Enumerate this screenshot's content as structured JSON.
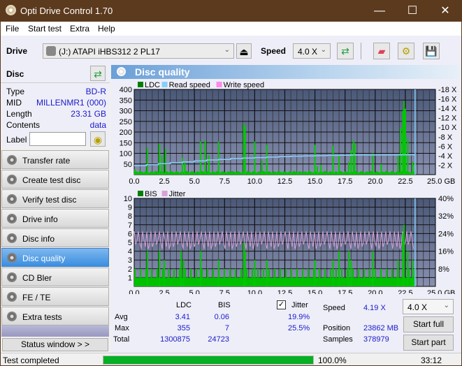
{
  "window": {
    "title": "Opti Drive Control 1.70",
    "controls": [
      "minimize",
      "maximize",
      "close"
    ]
  },
  "menu": [
    "File",
    "Start test",
    "Extra",
    "Help"
  ],
  "toolbar": {
    "drive_label": "Drive",
    "drive_value": "(J:)  ATAPI iHBS312  2 PL17",
    "speed_label": "Speed",
    "speed_value": "4.0 X",
    "icons": [
      "eject-icon",
      "refresh-icon",
      "erase-icon",
      "settings-icon",
      "save-icon"
    ]
  },
  "disc": {
    "header": "Disc",
    "rows": [
      {
        "key": "Type",
        "value": "BD-R"
      },
      {
        "key": "MID",
        "value": "MILLENMR1 (000)"
      },
      {
        "key": "Length",
        "value": "23.31 GB"
      },
      {
        "key": "Contents",
        "value": "data"
      }
    ],
    "label_key": "Label",
    "label_value": ""
  },
  "nav": [
    {
      "label": "Transfer rate",
      "active": false
    },
    {
      "label": "Create test disc",
      "active": false
    },
    {
      "label": "Verify test disc",
      "active": false
    },
    {
      "label": "Drive info",
      "active": false
    },
    {
      "label": "Disc info",
      "active": false
    },
    {
      "label": "Disc quality",
      "active": true
    },
    {
      "label": "CD Bler",
      "active": false
    },
    {
      "label": "FE / TE",
      "active": false
    },
    {
      "label": "Extra tests",
      "active": false
    }
  ],
  "status_window_label": "Status window > >",
  "panel_title": "Disc quality",
  "chart_data": [
    {
      "type": "bar",
      "title": "LDC / Read speed",
      "legend": [
        {
          "name": "LDC",
          "color": "#008000"
        },
        {
          "name": "Read speed",
          "color": "#87cefa"
        },
        {
          "name": "Write speed",
          "color": "#ff88ee"
        }
      ],
      "xlabel": "GB",
      "xlim": [
        0,
        25
      ],
      "x_ticks": [
        "0.0",
        "2.5",
        "5.0",
        "7.5",
        "10.0",
        "12.5",
        "15.0",
        "17.5",
        "20.0",
        "22.5",
        "25.0 GB"
      ],
      "ylim": [
        0,
        400
      ],
      "y_ticks": [
        "400",
        "350",
        "300",
        "250",
        "200",
        "150",
        "100",
        "50"
      ],
      "y2lim": [
        0,
        18
      ],
      "y2_ticks": [
        "18 X",
        "16 X",
        "14 X",
        "12 X",
        "10 X",
        "8 X",
        "6 X",
        "4 X",
        "2 X"
      ],
      "grid": true,
      "ldc_spikes": [
        [
          0.05,
          25
        ],
        [
          1.1,
          125
        ],
        [
          2.1,
          145
        ],
        [
          2.3,
          90
        ],
        [
          2.6,
          120
        ],
        [
          4.0,
          80
        ],
        [
          4.2,
          60
        ],
        [
          5.5,
          155
        ],
        [
          5.9,
          160
        ],
        [
          6.2,
          90
        ],
        [
          7.0,
          155
        ],
        [
          9.1,
          240
        ],
        [
          9.2,
          225
        ],
        [
          10.0,
          155
        ],
        [
          10.6,
          65
        ],
        [
          11.0,
          140
        ],
        [
          15.0,
          140
        ],
        [
          15.2,
          40
        ],
        [
          15.5,
          45
        ],
        [
          16.5,
          135
        ],
        [
          17.0,
          90
        ],
        [
          17.8,
          60
        ],
        [
          18.0,
          115
        ],
        [
          18.2,
          160
        ],
        [
          18.3,
          145
        ],
        [
          19.8,
          100
        ],
        [
          20.5,
          50
        ],
        [
          21.9,
          90
        ],
        [
          22.1,
          220
        ],
        [
          22.3,
          300
        ],
        [
          22.4,
          345
        ],
        [
          22.5,
          310
        ],
        [
          22.7,
          170
        ],
        [
          23.1,
          60
        ],
        [
          23.3,
          60
        ]
      ],
      "ldc_baseline": 8,
      "read_speed_x": [
        [
          0,
          1.9
        ],
        [
          1,
          2.1
        ],
        [
          2,
          2.3
        ],
        [
          3,
          2.5
        ],
        [
          4,
          2.7
        ],
        [
          5,
          2.9
        ],
        [
          6,
          3.1
        ],
        [
          7,
          3.2
        ],
        [
          8,
          3.4
        ],
        [
          9,
          3.5
        ],
        [
          10,
          3.6
        ],
        [
          11,
          3.7
        ],
        [
          12,
          3.8
        ],
        [
          13,
          3.9
        ],
        [
          14,
          3.95
        ],
        [
          15,
          4.0
        ],
        [
          16,
          4.05
        ],
        [
          17,
          4.1
        ],
        [
          18,
          4.15
        ],
        [
          19,
          4.15
        ],
        [
          20,
          4.15
        ],
        [
          21,
          4.17
        ],
        [
          22,
          4.18
        ],
        [
          23.3,
          4.19
        ]
      ],
      "end_marker_gb": 23.31
    },
    {
      "type": "bar",
      "title": "BIS / Jitter",
      "legend": [
        {
          "name": "BIS",
          "color": "#008000"
        },
        {
          "name": "Jitter",
          "color": "#d8a0d8"
        }
      ],
      "xlabel": "GB",
      "xlim": [
        0,
        25
      ],
      "x_ticks": [
        "0.0",
        "2.5",
        "5.0",
        "7.5",
        "10.0",
        "12.5",
        "15.0",
        "17.5",
        "20.0",
        "22.5",
        "25.0 GB"
      ],
      "ylim": [
        0,
        10
      ],
      "y_ticks": [
        "10",
        "9",
        "8",
        "7",
        "6",
        "5",
        "4",
        "3",
        "2",
        "1"
      ],
      "y2lim": [
        0,
        40
      ],
      "y2_ticks": [
        "40%",
        "32%",
        "24%",
        "16%",
        "8%"
      ],
      "grid": true,
      "bis_spikes": [
        [
          1.1,
          4
        ],
        [
          2.1,
          4
        ],
        [
          2.5,
          3
        ],
        [
          3.9,
          4
        ],
        [
          4.1,
          3
        ],
        [
          5.5,
          4
        ],
        [
          7.0,
          3
        ],
        [
          9.1,
          5
        ],
        [
          9.2,
          4
        ],
        [
          10.0,
          3
        ],
        [
          11.0,
          3
        ],
        [
          15.0,
          3
        ],
        [
          16.5,
          3
        ],
        [
          17.0,
          4
        ],
        [
          17.8,
          4
        ],
        [
          18.0,
          3
        ],
        [
          19.8,
          4
        ],
        [
          21.9,
          3
        ],
        [
          22.3,
          6
        ],
        [
          22.4,
          7
        ],
        [
          22.7,
          4
        ],
        [
          23.1,
          3
        ]
      ],
      "bis_level": 1,
      "jitter_range_pct": [
        17,
        25
      ],
      "end_marker_gb": 23.31
    }
  ],
  "stats": {
    "cols": [
      "LDC",
      "BIS"
    ],
    "rows": [
      {
        "label": "Avg",
        "ldc": "3.41",
        "bis": "0.06",
        "jitter": "19.9%"
      },
      {
        "label": "Max",
        "ldc": "355",
        "bis": "7",
        "jitter": "25.5%"
      },
      {
        "label": "Total",
        "ldc": "1300875",
        "bis": "24723",
        "jitter": ""
      }
    ],
    "jitter_label": "Jitter",
    "jitter_checked": true,
    "speed_label": "Speed",
    "speed_value": "4.19 X",
    "position_label": "Position",
    "position_value": "23862 MB",
    "samples_label": "Samples",
    "samples_value": "378979",
    "speed_select": "4.0 X",
    "start_full": "Start full",
    "start_part": "Start part"
  },
  "status": {
    "text": "Test completed",
    "progress": 100.0,
    "progress_label": "100.0%",
    "time": "33:12"
  }
}
